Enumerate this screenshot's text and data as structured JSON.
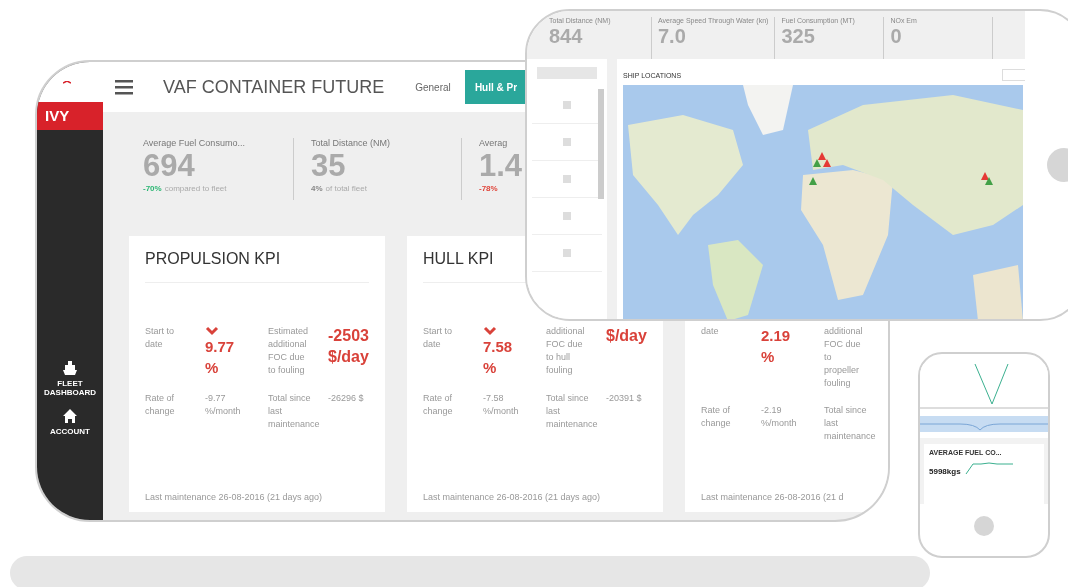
{
  "laptop": {
    "brand": "IVY",
    "title": "VAF CONTAINER FUTURE",
    "nav": [
      {
        "label": "FLEET DASHBOARD",
        "kind": "ship"
      },
      {
        "label": "ACCOUNT",
        "kind": "home"
      }
    ],
    "tabs": [
      {
        "label": "General",
        "selected": false
      },
      {
        "label": "Hull & Pr",
        "selected": true
      }
    ],
    "stats": [
      {
        "label": "Average Fuel Consumo...",
        "value": "694",
        "change": "-70%",
        "note": "compared to fleet",
        "color": "#2bb673"
      },
      {
        "label": "Total Distance (NM)",
        "value": "35",
        "change": "4%",
        "note": "of total fleet",
        "color": "#888888"
      },
      {
        "label": "Averag",
        "value": "1.4",
        "change": "-78%",
        "color": "#e0453a"
      }
    ],
    "cards": [
      {
        "title": "PROPULSION KPI",
        "start_label": "Start to date",
        "trend_down": true,
        "start_value": "9.77 %",
        "est_label": "Estimated additional FOC due to fouling",
        "est_value": "-2503 $/day",
        "rate_label": "Rate of change",
        "rate_value": "-9.77 %/month",
        "total_label": "Total since last maintenance",
        "total_value": "-26296 $",
        "footer": "Last maintenance 26-08-2016 (21 days ago)"
      },
      {
        "title": "HULL KPI",
        "start_label": "Start to date",
        "trend_down": true,
        "start_value": "7.58 %",
        "est_label": "additional FOC due to hull fouling",
        "est_value": "$/day",
        "rate_label": "Rate of change",
        "rate_value": "-7.58 %/month",
        "total_label": "Total since last maintenance",
        "total_value": "-20391 $",
        "footer": "Last maintenance 26-08-2016 (21 days ago)"
      },
      {
        "start_label": "date",
        "start_value": "2.19 %",
        "est_label": "additional FOC due to propeller fouling",
        "rate_label": "Rate of change",
        "rate_value": "-2.19 %/month",
        "total_label": "Total since last maintenance",
        "footer": "Last maintenance 26-08-2016 (21 d"
      }
    ]
  },
  "tablet": {
    "stats": [
      {
        "label": "Total Distance (NM)",
        "value": "844"
      },
      {
        "label": "Average Speed Through Water (kn)",
        "value": "7.0"
      },
      {
        "label": "Fuel Consumption (MT)",
        "value": "325"
      },
      {
        "label": "NOx Em",
        "value": "0"
      }
    ],
    "list": [
      {
        "checked": false
      },
      {
        "checked": false
      },
      {
        "checked": false
      },
      {
        "checked": false
      },
      {
        "checked": false
      }
    ],
    "map_title": "SHIP LOCATIONS"
  },
  "phone": {
    "card_title": "AVERAGE FUEL CO...",
    "card_value": "5998kgs"
  }
}
